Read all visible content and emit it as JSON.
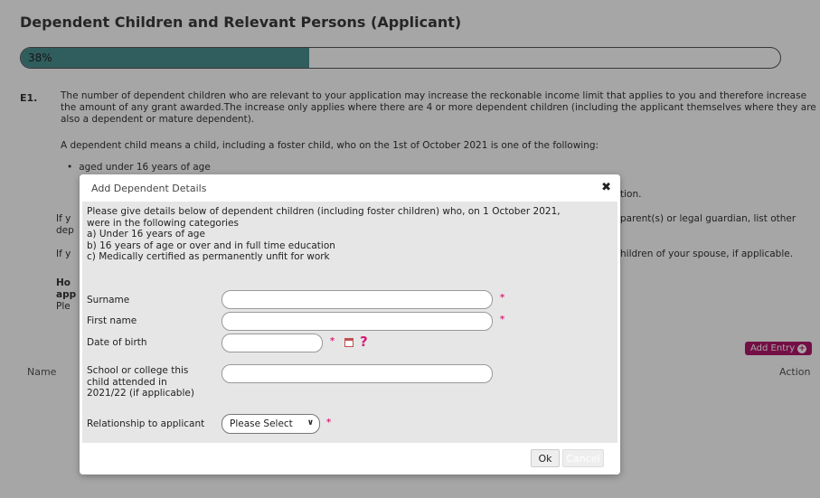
{
  "page": {
    "title": "Dependent Children and Relevant Persons (Applicant)",
    "progress": {
      "label": "38%",
      "value": 0.38,
      "color": "#4a8f8f"
    },
    "question_number": "E1.",
    "paragraph1": "The number of dependent children who are relevant to your application may increase the reckonable income limit that applies to you and therefore increase the amount of any grant awarded.The increase only applies where there are 4 or more dependent children (including the applicant themselves where they are also a dependent or mature dependent).",
    "paragraph2": "A dependent child means a child, including a foster child, who on the 1st of October 2021 is one of the following:",
    "bullet1": "aged under 16 years of age",
    "left_fragments": [
      "If y",
      "dep",
      "If y",
      "Ho",
      "app",
      "Ple"
    ],
    "right_fragments": [
      "tion.",
      "parent(s) or legal guardian, list other",
      "hildren of your spouse, if applicable."
    ],
    "add_entry_label": "Add Entry",
    "table": {
      "col_name": "Name",
      "col_action": "Action"
    }
  },
  "modal": {
    "title": "Add Dependent Details",
    "close_glyph": "✖",
    "intro": [
      "Please give details below of dependent children (including foster children) who, on 1 October 2021,",
      "were in the following categories",
      "a) Under 16 years of age",
      "b) 16 years of age or over and in full time education",
      "c) Medically certified as permanently unfit for work"
    ],
    "fields": {
      "surname_label": "Surname",
      "surname_value": "",
      "first_name_label": "First name",
      "first_name_value": "",
      "dob_label": "Date of birth",
      "dob_value": "",
      "school_label_lines": [
        "School or college this",
        "child attended in",
        "2021/22 (if applicable)"
      ],
      "school_value": "",
      "relationship_label": "Relationship to applicant",
      "relationship_selected": "Please Select"
    },
    "required_mark": "*",
    "help_glyph": "?",
    "ok_label": "Ok",
    "cancel_label": "Cancel"
  },
  "colors": {
    "accent": "#b3186a",
    "required": "#e0267d"
  }
}
